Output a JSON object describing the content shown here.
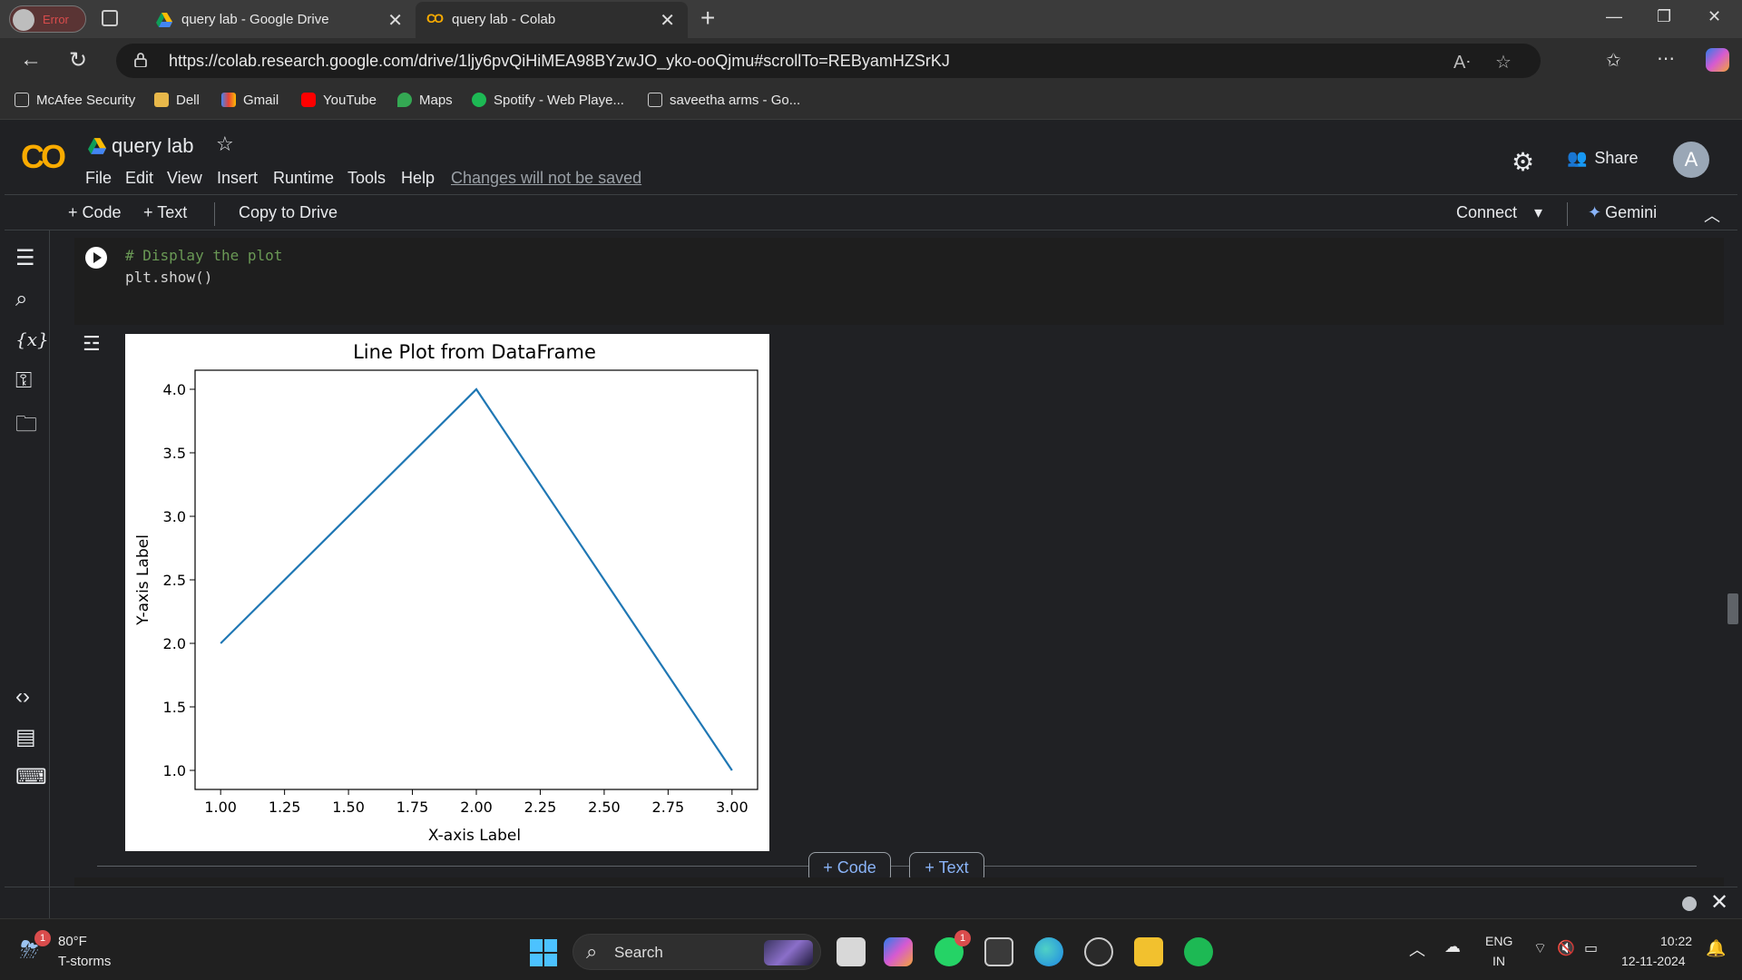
{
  "browser": {
    "profile_status": "Error",
    "tabs": [
      {
        "title": "query lab - Google Drive",
        "active": false
      },
      {
        "title": "query lab - Colab",
        "active": true
      }
    ],
    "url": "https://colab.research.google.com/drive/1ljy6pvQiHiMEA98BYzwJO_yko-ooQjmu#scrollTo=REByamHZSrKJ",
    "bookmarks": [
      "McAfee Security",
      "Dell",
      "Gmail",
      "YouTube",
      "Maps",
      "Spotify - Web Playe...",
      "saveetha arms - Go..."
    ]
  },
  "colab": {
    "logo": "CO",
    "notebook_title": "query lab",
    "menu": [
      "File",
      "Edit",
      "View",
      "Insert",
      "Runtime",
      "Tools",
      "Help"
    ],
    "unsaved_notice": "Changes will not be saved",
    "share_label": "Share",
    "avatar_letter": "A",
    "toolbar": {
      "add_code": "+ Code",
      "add_text": "+ Text",
      "copy_to_drive": "Copy to Drive",
      "connect": "Connect",
      "gemini": "Gemini"
    },
    "cell": {
      "line1": "# Display the plot",
      "line2": "plt.show()"
    },
    "add_code_button": "+ Code",
    "add_text_button": "+ Text"
  },
  "chart_data": {
    "type": "line",
    "title": "Line Plot from DataFrame",
    "xlabel": "X-axis Label",
    "ylabel": "Y-axis Label",
    "x": [
      1,
      2,
      3
    ],
    "series": [
      {
        "values": [
          2,
          4,
          1
        ],
        "color": "#1f77b4"
      }
    ],
    "xlim": [
      0.9,
      3.1
    ],
    "ylim": [
      0.85,
      4.15
    ],
    "xticks": [
      "1.00",
      "1.25",
      "1.50",
      "1.75",
      "2.00",
      "2.25",
      "2.50",
      "2.75",
      "3.00"
    ],
    "xtick_values": [
      1.0,
      1.25,
      1.5,
      1.75,
      2.0,
      2.25,
      2.5,
      2.75,
      3.0
    ],
    "yticks": [
      "1.0",
      "1.5",
      "2.0",
      "2.5",
      "3.0",
      "3.5",
      "4.0"
    ],
    "ytick_values": [
      1.0,
      1.5,
      2.0,
      2.5,
      3.0,
      3.5,
      4.0
    ],
    "grid": false,
    "legend": "none"
  },
  "taskbar": {
    "weather_temp": "80°F",
    "weather_desc": "T-storms",
    "weather_badge": "1",
    "search_label": "Search",
    "whatsapp_badge": "1",
    "lang_line1": "ENG",
    "lang_line2": "IN",
    "time": "10:22",
    "date": "12-11-2024"
  }
}
